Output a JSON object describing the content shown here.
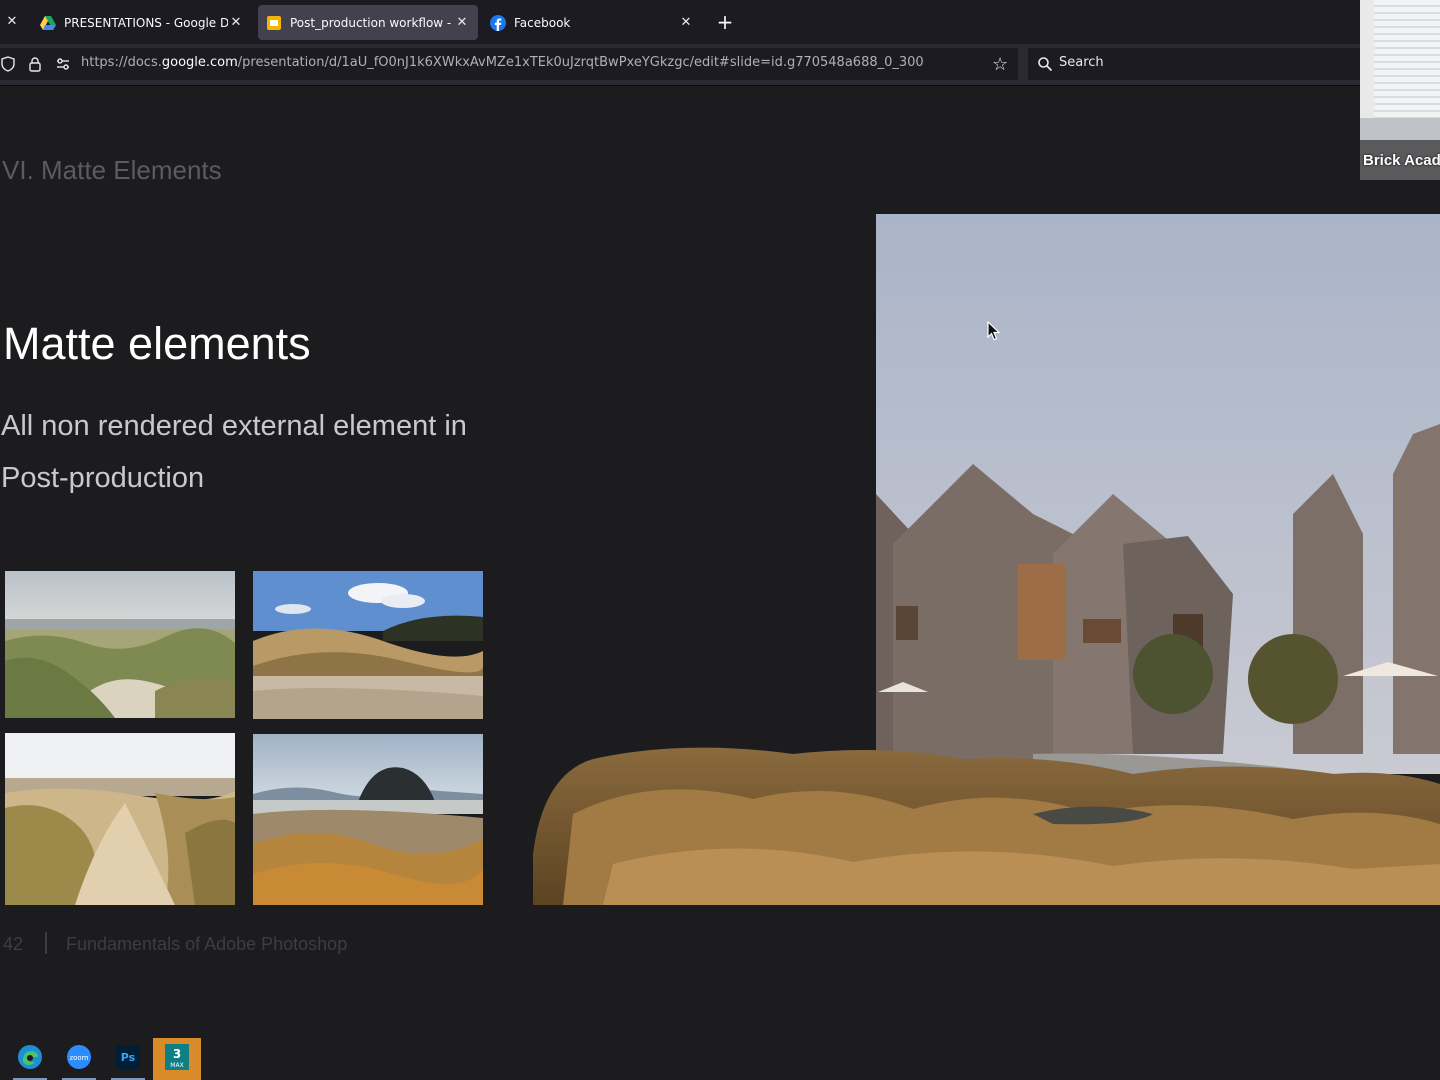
{
  "browser": {
    "tabs": [
      {
        "title": "PRESENTATIONS - Google Drive",
        "icon": "google-drive-icon",
        "active": false
      },
      {
        "title": "Post_production workflow - ne",
        "icon": "google-slides-icon",
        "active": true
      },
      {
        "title": "Facebook",
        "icon": "facebook-icon",
        "active": false
      }
    ],
    "url_prefix": "https://docs.",
    "url_host": "google.com",
    "url_path": "/presentation/d/1aU_fO0nJ1k6XWkxAvMZe1xTEk0uJzrqtBwPxeYGkzgc/edit#slide=id.g770548a688_0_300",
    "search_placeholder": "Search"
  },
  "webcam": {
    "name": "Brick Acad"
  },
  "slide": {
    "section_title": "VI. Matte Elements",
    "heading": "Matte elements",
    "subtitle_line1": "All non rendered external element in",
    "subtitle_line2": "Post-production",
    "page_number": "42",
    "footer_text": "Fundamentals of Adobe Photoshop",
    "images": [
      "dune-grass-photo",
      "beach-grass-photo",
      "sand-path-photo",
      "rock-dune-photo",
      "architectural-render-with-grass"
    ]
  },
  "taskbar": {
    "apps": [
      "edge-icon",
      "zoom-icon",
      "photoshop-icon",
      "3dsmax-icon"
    ],
    "labels": {
      "zoom": "zoom",
      "photoshop": "Ps",
      "max_num": "3",
      "max_text": "MAX"
    }
  },
  "colors": {
    "background": "#1c1c1e",
    "tabbar": "#1c1b22",
    "active_tab": "#42414d",
    "heading": "#ffffff",
    "section": "#5b5b60"
  }
}
